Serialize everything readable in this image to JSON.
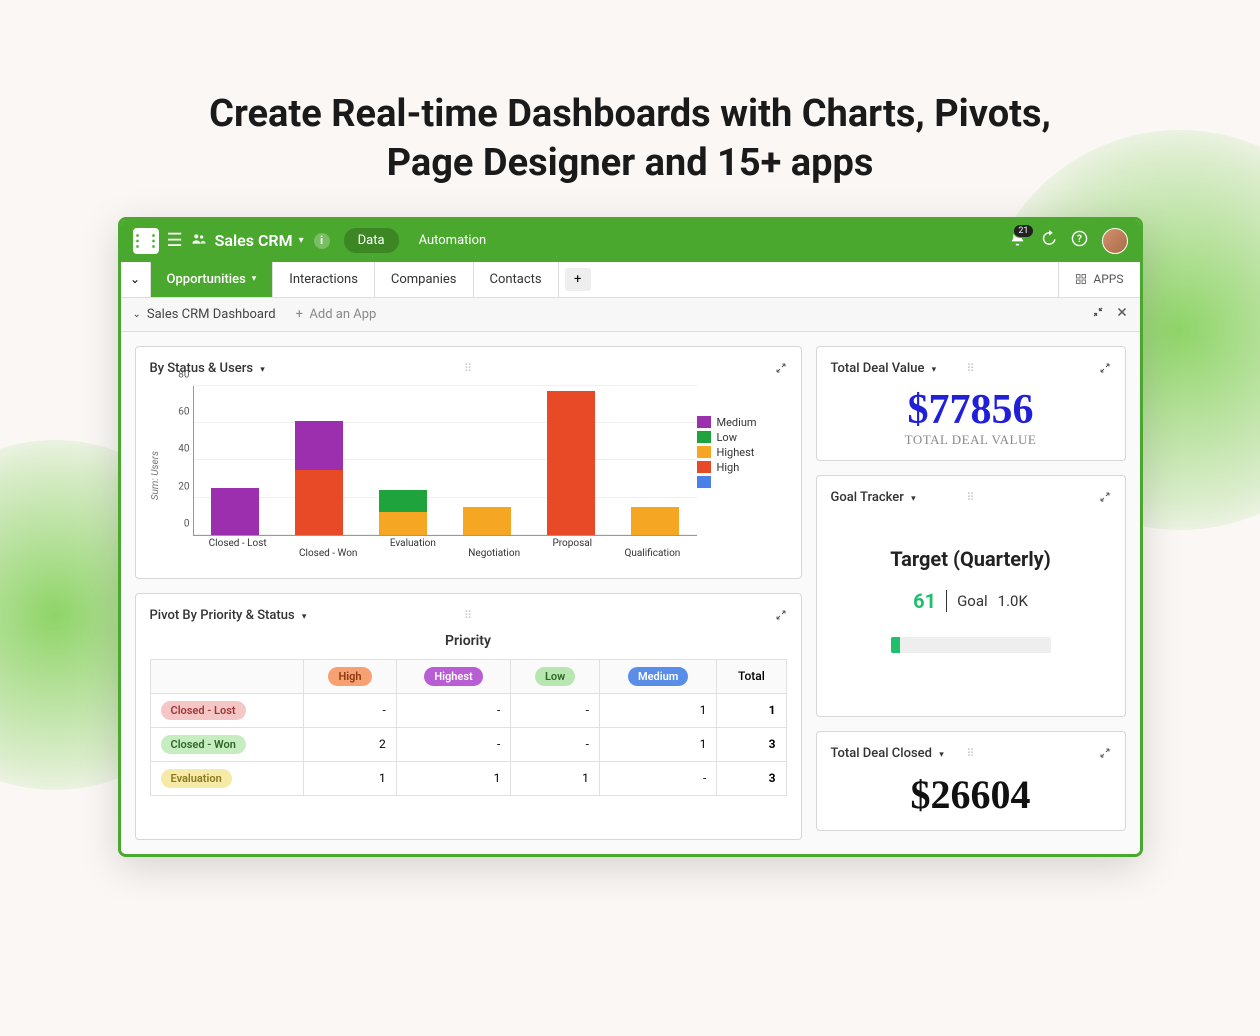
{
  "hero": {
    "line1": "Create Real-time Dashboards with Charts, Pivots,",
    "line2": "Page Designer and 15+ apps"
  },
  "topbar": {
    "app_title": "Sales CRM",
    "badge_count": "21",
    "nav": {
      "data": "Data",
      "automation": "Automation"
    }
  },
  "tabs": {
    "opportunities": "Opportunities",
    "interactions": "Interactions",
    "companies": "Companies",
    "contacts": "Contacts",
    "apps": "APPS"
  },
  "subbar": {
    "title": "Sales CRM Dashboard",
    "add": "Add an App"
  },
  "widgets": {
    "status_users": {
      "title": "By Status & Users"
    },
    "pivot": {
      "title": "Pivot By Priority & Status",
      "heading": "Priority"
    },
    "deal_value": {
      "title": "Total Deal Value",
      "amount": "$77856",
      "label": "TOTAL DEAL VALUE"
    },
    "goal": {
      "title": "Goal Tracker",
      "heading": "Target (Quarterly)",
      "current": "61",
      "goal_label": "Goal",
      "goal_total": "1.0K",
      "progress_pct": 6
    },
    "closed": {
      "title": "Total Deal Closed",
      "amount": "$26604"
    }
  },
  "colors": {
    "medium": "#9b2fae",
    "low": "#1fa33c",
    "highest": "#f5a623",
    "high": "#e84a27",
    "blank": "#4a80e8"
  },
  "chart_data": {
    "type": "bar",
    "title": "By Status & Users",
    "ylabel": "Sum: Users",
    "ylim": [
      0,
      80
    ],
    "y_ticks": [
      0,
      20,
      40,
      60,
      80
    ],
    "categories": [
      "Closed - Lost",
      "Closed - Won",
      "Evaluation",
      "Negotiation",
      "Proposal",
      "Qualification"
    ],
    "legend": [
      "Medium",
      "Low",
      "Highest",
      "High",
      ""
    ],
    "stacked": true,
    "series_by_category": [
      {
        "category": "Closed - Lost",
        "stack": [
          {
            "name": "Medium",
            "value": 25
          }
        ]
      },
      {
        "category": "Closed - Won",
        "stack": [
          {
            "name": "High",
            "value": 35
          },
          {
            "name": "Medium",
            "value": 26
          }
        ]
      },
      {
        "category": "Evaluation",
        "stack": [
          {
            "name": "Highest",
            "value": 12
          },
          {
            "name": "Low",
            "value": 12
          }
        ]
      },
      {
        "category": "Negotiation",
        "stack": [
          {
            "name": "Highest",
            "value": 15
          }
        ]
      },
      {
        "category": "Proposal",
        "stack": [
          {
            "name": "High",
            "value": 77
          }
        ]
      },
      {
        "category": "Qualification",
        "stack": [
          {
            "name": "Highest",
            "value": 15
          }
        ]
      }
    ]
  },
  "pivot_data": {
    "columns": [
      "High",
      "Highest",
      "Low",
      "Medium",
      "Total"
    ],
    "rows": [
      {
        "label": "Closed - Lost",
        "pill": "pill-closedlost",
        "cells": [
          "-",
          "-",
          "-",
          "1",
          "1"
        ]
      },
      {
        "label": "Closed - Won",
        "pill": "pill-closedwon",
        "cells": [
          "2",
          "-",
          "-",
          "1",
          "3"
        ]
      },
      {
        "label": "Evaluation",
        "pill": "pill-eval",
        "cells": [
          "1",
          "1",
          "1",
          "-",
          "3"
        ]
      }
    ]
  }
}
